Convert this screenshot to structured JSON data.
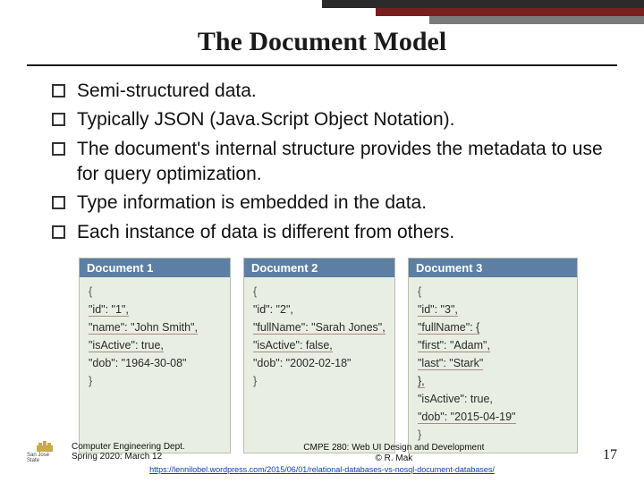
{
  "title": "The Document Model",
  "bullets": [
    "Semi-structured data.",
    "Typically JSON (Java.Script Object Notation).",
    "The document's internal structure provides the metadata to use for query optimization.",
    "Type information is embedded in the data.",
    "Each instance of data is different from others."
  ],
  "documents": [
    {
      "header": "Document 1",
      "lines": [
        "{",
        "\"id\": \"1\",",
        "\"name\": \"John Smith\",",
        "\"isActive\": true,",
        "\"dob\": \"1964-30-08\"",
        "}"
      ],
      "highlight_idx": [
        1,
        2,
        3
      ]
    },
    {
      "header": "Document 2",
      "lines": [
        "{",
        "\"id\": \"2\",",
        "\"fullName\": \"Sarah Jones\",",
        "\"isActive\": false,",
        "\"dob\": \"2002-02-18\"",
        "}"
      ],
      "highlight_idx": [
        2,
        3
      ]
    },
    {
      "header": "Document 3",
      "lines": [
        "{",
        "\"id\": \"3\",",
        "\"fullName\": {",
        "    \"first\": \"Adam\",",
        "    \"last\": \"Stark\"",
        "},",
        "\"isActive\": true,",
        "\"dob\": \"2015-04-19\"",
        "}"
      ],
      "highlight_idx": [
        1,
        2,
        3,
        4,
        5,
        7
      ]
    }
  ],
  "footer": {
    "dept": "Computer Engineering Dept.",
    "term": "Spring 2020: March 12",
    "course": "CMPE 280: Web UI Design and Development",
    "author": "© R. Mak",
    "cite": "https://lennilobel.wordpress.com/2015/06/01/relational-databases-vs-nosql-document-databases/",
    "page": "17",
    "logo_text": "San José State"
  }
}
